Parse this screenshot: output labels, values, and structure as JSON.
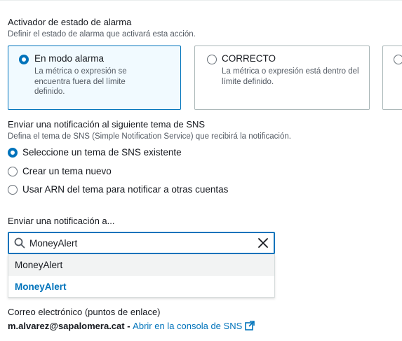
{
  "alarm_trigger": {
    "title": "Activador de estado de alarma",
    "description": "Definir el estado de alarma que activará esta acción.",
    "options": [
      {
        "title": "En modo alarma",
        "description": "La métrica o expresión se encuentra fuera del límite definido.",
        "selected": true
      },
      {
        "title": "CORRECTO",
        "description": "La métrica o expresión está dentro del límite definido.",
        "selected": false
      }
    ]
  },
  "sns": {
    "title": "Enviar una notificación al siguiente tema de SNS",
    "description": "Defina el tema de SNS (Simple Notification Service) que recibirá la notificación.",
    "options": [
      {
        "label": "Seleccione un tema de SNS existente",
        "selected": true
      },
      {
        "label": "Crear un tema nuevo",
        "selected": false
      },
      {
        "label": "Usar ARN del tema para notificar a otras cuentas",
        "selected": false
      }
    ]
  },
  "send_to": {
    "label": "Enviar una notificación a...",
    "search_value": "MoneyAlert",
    "results": [
      "MoneyAlert",
      "MoneyAlert"
    ]
  },
  "endpoints": {
    "label": "Correo electrónico (puntos de enlace)",
    "email": "m.alvarez@sapalomera.cat",
    "separator": " - ",
    "console_link": "Abrir en la consola de SNS"
  },
  "colors": {
    "accent": "#0073bb",
    "text": "#16191f",
    "muted": "#545b64",
    "border": "#aab7b8"
  },
  "icons": [
    "search-icon",
    "clear-icon",
    "external-link-icon"
  ]
}
